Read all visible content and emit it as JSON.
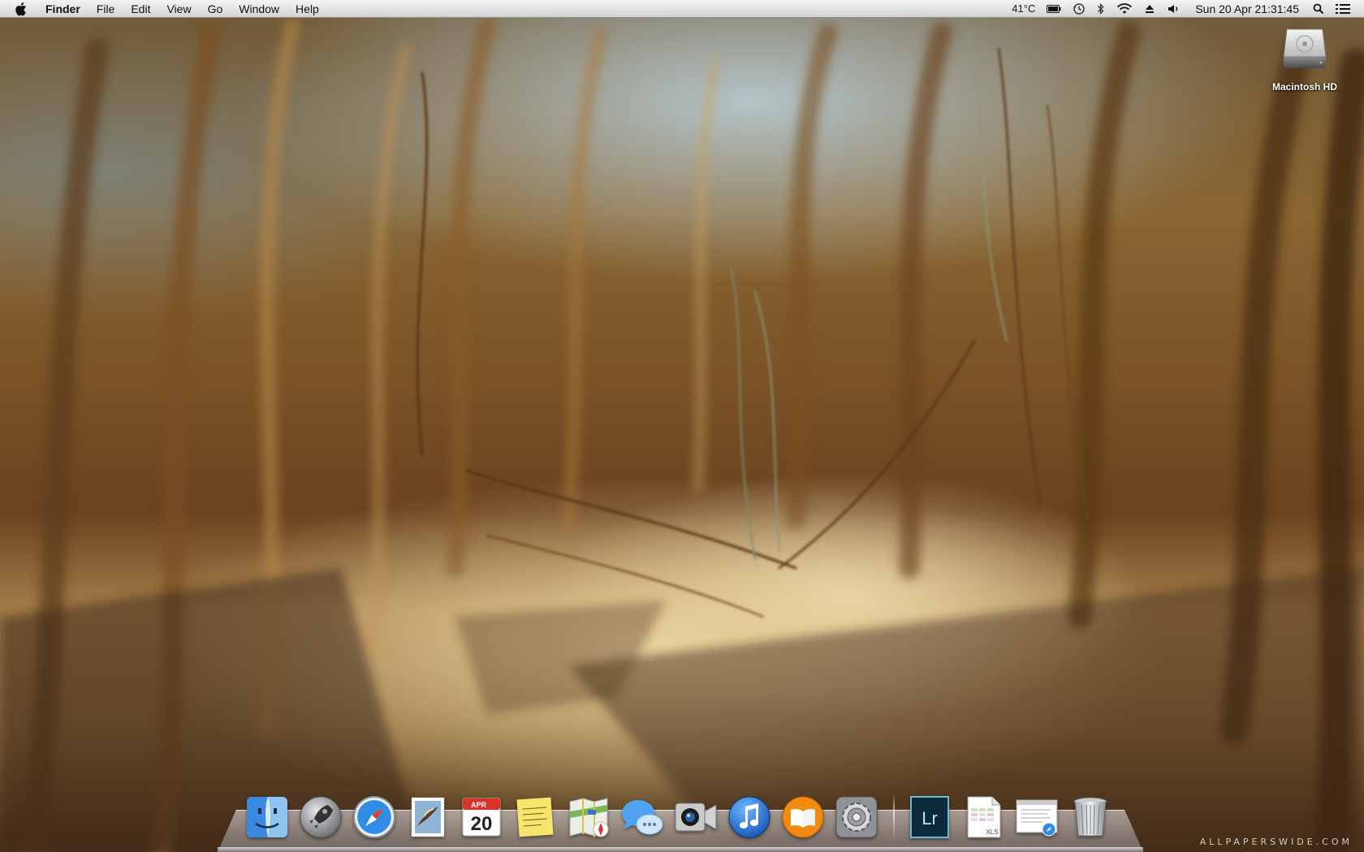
{
  "menubar": {
    "app_name": "Finder",
    "menus": [
      "File",
      "Edit",
      "View",
      "Go",
      "Window",
      "Help"
    ],
    "status": {
      "temperature": "41°C",
      "icons": [
        "battery-icon",
        "time-machine-icon",
        "bluetooth-icon",
        "wifi-icon",
        "eject-icon",
        "volume-icon"
      ],
      "clock": "Sun 20 Apr  21:31:45"
    }
  },
  "desktop": {
    "icons": [
      {
        "label": "Macintosh HD",
        "icon": "hard-drive-icon"
      }
    ]
  },
  "dock": {
    "apps": [
      {
        "name": "finder",
        "icon": "finder-icon"
      },
      {
        "name": "launchpad",
        "icon": "rocket-icon"
      },
      {
        "name": "safari",
        "icon": "compass-icon"
      },
      {
        "name": "mail",
        "icon": "stamp-icon"
      },
      {
        "name": "calendar",
        "icon": "calendar-icon",
        "month": "APR",
        "day": "20"
      },
      {
        "name": "notes",
        "icon": "notes-icon"
      },
      {
        "name": "maps",
        "icon": "map-icon"
      },
      {
        "name": "messages",
        "icon": "chat-bubbles-icon"
      },
      {
        "name": "facetime",
        "icon": "camera-icon"
      },
      {
        "name": "itunes",
        "icon": "music-note-icon"
      },
      {
        "name": "ibooks",
        "icon": "book-icon"
      },
      {
        "name": "system-preferences",
        "icon": "gear-icon"
      }
    ],
    "others": [
      {
        "name": "lightroom",
        "icon": "lightroom-icon",
        "text": "Lr"
      },
      {
        "name": "xls-document",
        "icon": "spreadsheet-document-icon",
        "text": "XLS"
      },
      {
        "name": "web-document",
        "icon": "web-document-icon"
      },
      {
        "name": "trash",
        "icon": "trash-icon"
      }
    ]
  },
  "watermark": "ALLPAPERSWIDE.COM",
  "colors": {
    "menubar": "#e3e3e3",
    "itunes_blue": "#1a6fd6",
    "ibooks_orange": "#f08a12",
    "lightroom_bg": "#0b2a3a"
  }
}
